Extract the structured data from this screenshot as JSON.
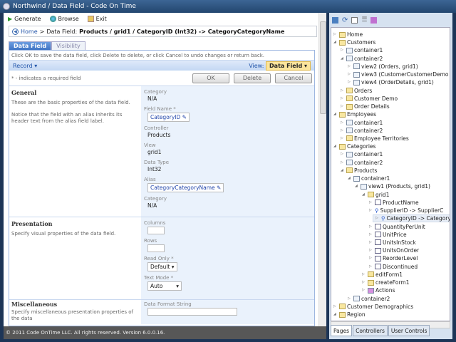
{
  "window": {
    "title": "Northwind / Data Field - Code On Time"
  },
  "toolbar": {
    "generate": "Generate",
    "browse": "Browse",
    "exit": "Exit"
  },
  "breadcrumb": {
    "home": "Home",
    "separator": ">",
    "prefix": "Data Field:",
    "path": "Products / grid1 / CategoryID (Int32) -> CategoryCategoryName"
  },
  "tabs": [
    {
      "label": "Data Field",
      "active": true
    },
    {
      "label": "Visibility",
      "active": false
    }
  ],
  "form": {
    "hint": "Click OK to save the data field, click Delete to delete, or click Cancel to undo changes or return back.",
    "record_menu": "Record",
    "view_label": "View:",
    "view_value": "Data Field",
    "required_note": "* - indicates a required field",
    "ok": "OK",
    "delete": "Delete",
    "cancel": "Cancel",
    "general": {
      "title": "General",
      "desc1": "These are the basic properties of the data field.",
      "desc2": "Notice that the field with an alias inherits its header text from the alias field label.",
      "category_label": "Category",
      "category_value": "N/A",
      "field_name_label": "Field Name *",
      "field_name_value": "CategoryID",
      "controller_label": "Controller",
      "controller_value": "Products",
      "view_label": "View",
      "view_value": "grid1",
      "data_type_label": "Data Type",
      "data_type_value": "Int32",
      "alias_label": "Alias",
      "alias_value": "CategoryCategoryName",
      "category2_label": "Category",
      "category2_value": "N/A"
    },
    "presentation": {
      "title": "Presentation",
      "desc": "Specify visual properties of the data field.",
      "columns_label": "Columns",
      "rows_label": "Rows",
      "read_only_label": "Read Only *",
      "read_only_value": "Default",
      "text_mode_label": "Text Mode *",
      "text_mode_value": "Auto"
    },
    "misc": {
      "title": "Miscellaneous",
      "desc": "Specify miscellaneous presentation properties of the data",
      "format_label": "Data Format String"
    }
  },
  "footer": "© 2011 Code OnTime LLC. All rights reserved. Version 6.0.0.16.",
  "tree": [
    {
      "l": 0,
      "t": "Home",
      "i": "page",
      "s": "c"
    },
    {
      "l": 0,
      "t": "Customers",
      "i": "page",
      "s": "e"
    },
    {
      "l": 1,
      "t": "container1",
      "i": "c",
      "s": "c"
    },
    {
      "l": 1,
      "t": "container2",
      "i": "c",
      "s": "e"
    },
    {
      "l": 2,
      "t": "view2 (Orders, grid1)",
      "i": "c",
      "s": "c"
    },
    {
      "l": 2,
      "t": "view3 (CustomerCustomerDemo",
      "i": "c",
      "s": "c"
    },
    {
      "l": 2,
      "t": "view4 (OrderDetails, grid1)",
      "i": "c",
      "s": "c"
    },
    {
      "l": 1,
      "t": "Orders",
      "i": "page",
      "s": "c"
    },
    {
      "l": 1,
      "t": "Customer Demo",
      "i": "page",
      "s": "c"
    },
    {
      "l": 1,
      "t": "Order Details",
      "i": "page",
      "s": "c"
    },
    {
      "l": 0,
      "t": "Employees",
      "i": "page",
      "s": "e"
    },
    {
      "l": 1,
      "t": "container1",
      "i": "c",
      "s": "c"
    },
    {
      "l": 1,
      "t": "container2",
      "i": "c",
      "s": "c"
    },
    {
      "l": 1,
      "t": "Employee Territories",
      "i": "page",
      "s": "c"
    },
    {
      "l": 0,
      "t": "Categories",
      "i": "page",
      "s": "e"
    },
    {
      "l": 1,
      "t": "container1",
      "i": "c",
      "s": "c"
    },
    {
      "l": 1,
      "t": "container2",
      "i": "c",
      "s": "c"
    },
    {
      "l": 1,
      "t": "Products",
      "i": "page",
      "s": "e"
    },
    {
      "l": 2,
      "t": "container1",
      "i": "c",
      "s": "e"
    },
    {
      "l": 3,
      "t": "view1 (Products, grid1)",
      "i": "c",
      "s": "e"
    },
    {
      "l": 4,
      "t": "grid1",
      "i": "page",
      "s": "e"
    },
    {
      "l": 5,
      "t": "ProductName",
      "i": "field",
      "s": "c"
    },
    {
      "l": 5,
      "t": "SupplierID -> SupplierC",
      "i": "lookup",
      "s": "c"
    },
    {
      "l": 5,
      "t": "CategoryID -> Category",
      "i": "lookup",
      "s": "c",
      "sel": true
    },
    {
      "l": 5,
      "t": "QuantityPerUnit",
      "i": "field",
      "s": "c"
    },
    {
      "l": 5,
      "t": "UnitPrice",
      "i": "field",
      "s": "c"
    },
    {
      "l": 5,
      "t": "UnitsInStock",
      "i": "field",
      "s": "c"
    },
    {
      "l": 5,
      "t": "UnitsOnOrder",
      "i": "field",
      "s": "c"
    },
    {
      "l": 5,
      "t": "ReorderLevel",
      "i": "field",
      "s": "c"
    },
    {
      "l": 5,
      "t": "Discontinued",
      "i": "field",
      "s": "c"
    },
    {
      "l": 4,
      "t": "editForm1",
      "i": "page",
      "s": "c"
    },
    {
      "l": 4,
      "t": "createForm1",
      "i": "page",
      "s": "c"
    },
    {
      "l": 4,
      "t": "Actions",
      "i": "actions",
      "s": "c"
    },
    {
      "l": 2,
      "t": "container2",
      "i": "c",
      "s": "c"
    },
    {
      "l": 0,
      "t": "Customer Demographics",
      "i": "page",
      "s": "c"
    },
    {
      "l": 0,
      "t": "Region",
      "i": "page",
      "s": "e"
    }
  ],
  "bottom_tabs": [
    {
      "label": "Pages",
      "active": true
    },
    {
      "label": "Controllers",
      "active": false
    },
    {
      "label": "User Controls",
      "active": false
    }
  ]
}
